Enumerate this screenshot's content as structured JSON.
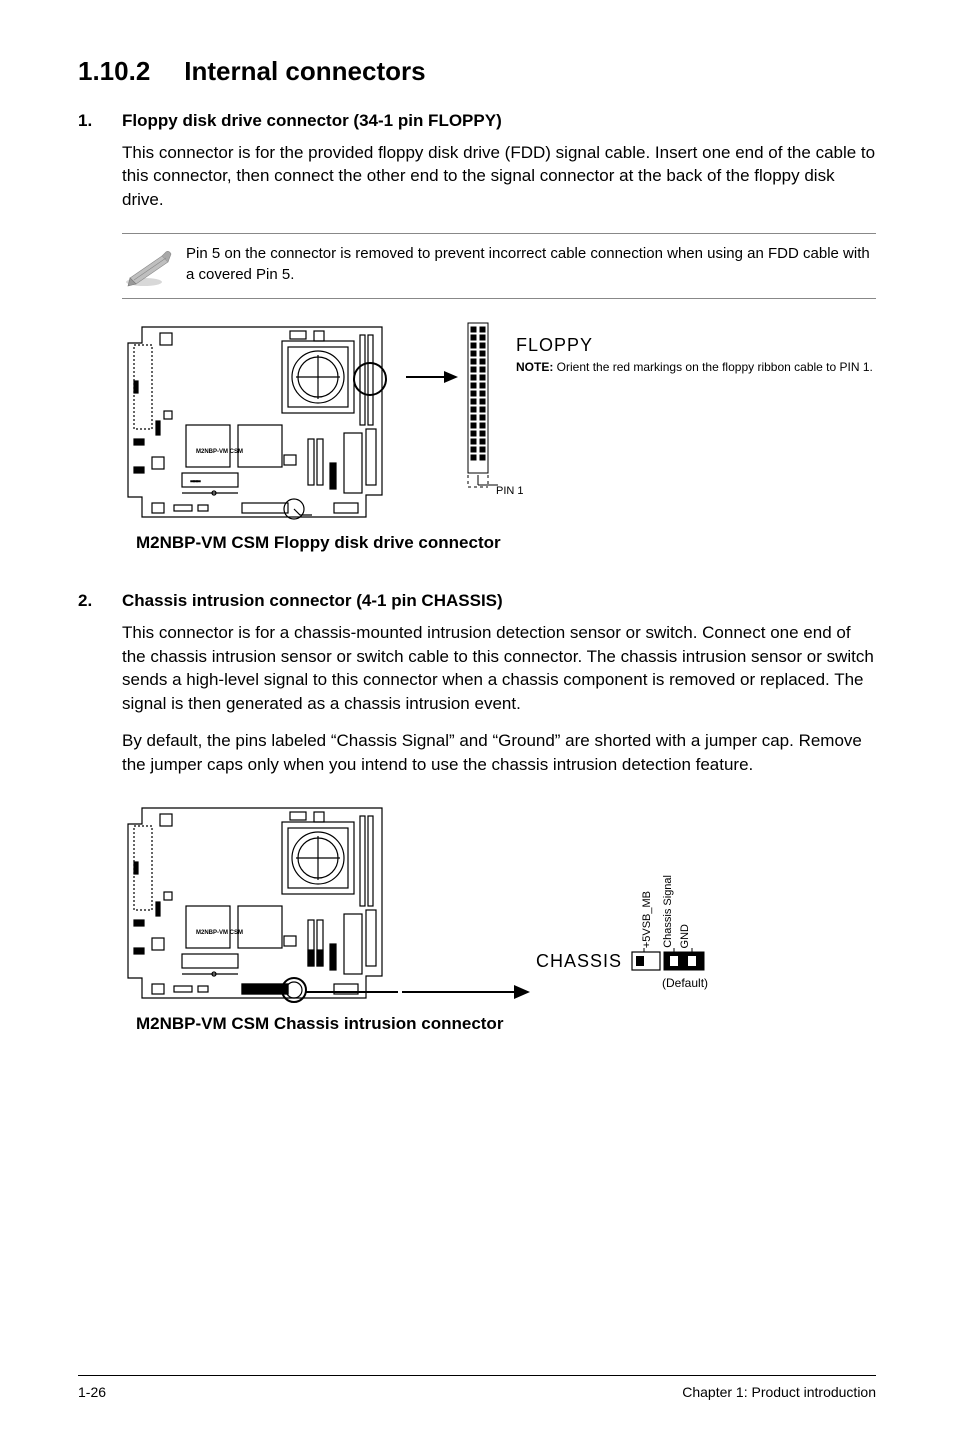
{
  "heading": {
    "number": "1.10.2",
    "title": "Internal connectors"
  },
  "item1": {
    "num": "1.",
    "title": "Floppy disk drive connector (34-1 pin FLOPPY)",
    "body": "This connector is for the provided floppy disk drive (FDD) signal cable. Insert one end of the cable to this connector, then connect the other end to the signal connector at the back of the floppy disk drive.",
    "note": "Pin 5 on the connector is removed to prevent incorrect cable connection when using an FDD cable with a covered Pin 5.",
    "mobo_label": "M2NBP-VM CSM",
    "floppy_label": "FLOPPY",
    "floppy_note_bold": "NOTE:",
    "floppy_note_rest": " Orient the red markings on the floppy ribbon cable to PIN 1.",
    "pin1": "PIN 1",
    "caption": "M2NBP-VM CSM Floppy disk drive connector"
  },
  "item2": {
    "num": "2.",
    "title": "Chassis intrusion connector (4-1 pin CHASSIS)",
    "body1": "This connector is for a chassis-mounted intrusion detection sensor or switch. Connect one end of the chassis intrusion sensor or switch cable to this connector. The chassis intrusion sensor or switch sends a high-level signal to this connector when a chassis component is removed or replaced. The signal is then generated as a chassis intrusion event.",
    "body2": "By default, the pins labeled “Chassis Signal” and “Ground” are shorted with a jumper cap. Remove the jumper caps only when you intend to use the chassis intrusion detection feature.",
    "mobo_label": "M2NBP-VM CSM",
    "chassis_label": "CHASSIS",
    "p1": "+5VSB_MB",
    "p2": "Chassis Signal",
    "p3": "GND",
    "default": "(Default)",
    "caption": "M2NBP-VM CSM Chassis intrusion connector"
  },
  "footer": {
    "page": "1-26",
    "chapter": "Chapter 1: Product introduction"
  }
}
